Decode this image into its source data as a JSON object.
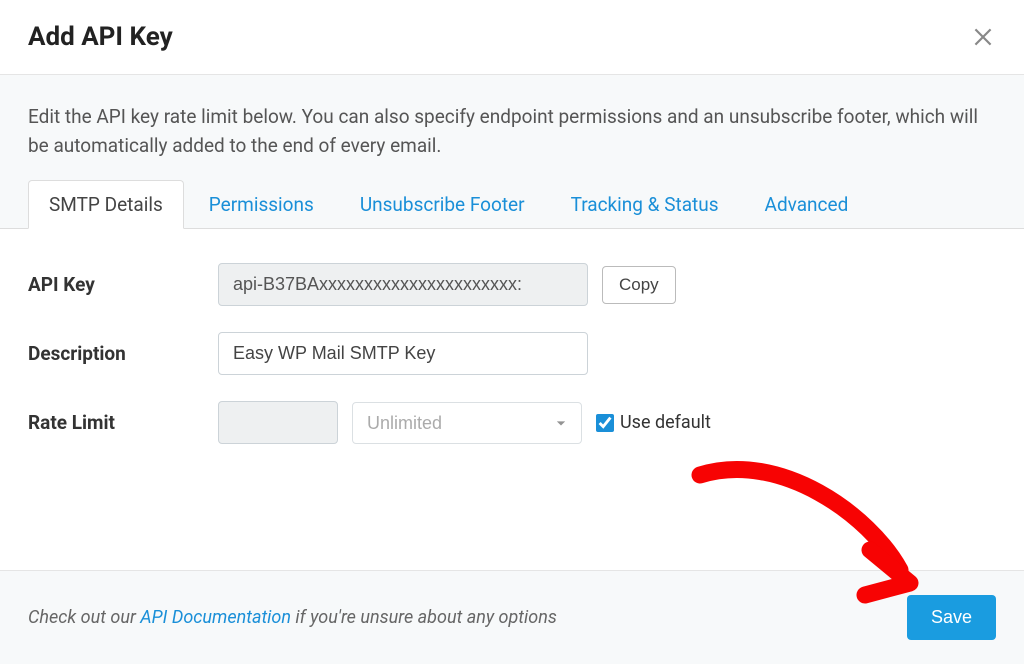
{
  "header": {
    "title": "Add API Key"
  },
  "intro": {
    "text": "Edit the API key rate limit below. You can also specify endpoint permissions and an unsubscribe footer, which will be automatically added to the end of every email."
  },
  "tabs": [
    {
      "label": "SMTP Details",
      "active": true
    },
    {
      "label": "Permissions",
      "active": false
    },
    {
      "label": "Unsubscribe Footer",
      "active": false
    },
    {
      "label": "Tracking & Status",
      "active": false
    },
    {
      "label": "Advanced",
      "active": false
    }
  ],
  "form": {
    "api_key": {
      "label": "API Key",
      "value": "api-B37BAxxxxxxxxxxxxxxxxxxxxxx:",
      "copy_label": "Copy"
    },
    "description": {
      "label": "Description",
      "value": "Easy WP Mail SMTP Key"
    },
    "rate_limit": {
      "label": "Rate Limit",
      "value": "",
      "select_value": "Unlimited",
      "use_default_label": "Use default",
      "use_default_checked": true
    }
  },
  "footer": {
    "prefix": "Check out our ",
    "link": "API Documentation",
    "suffix": " if you're unsure about any options",
    "save_label": "Save"
  },
  "colors": {
    "accent": "#1a9ce0",
    "annotation": "#f70303"
  }
}
